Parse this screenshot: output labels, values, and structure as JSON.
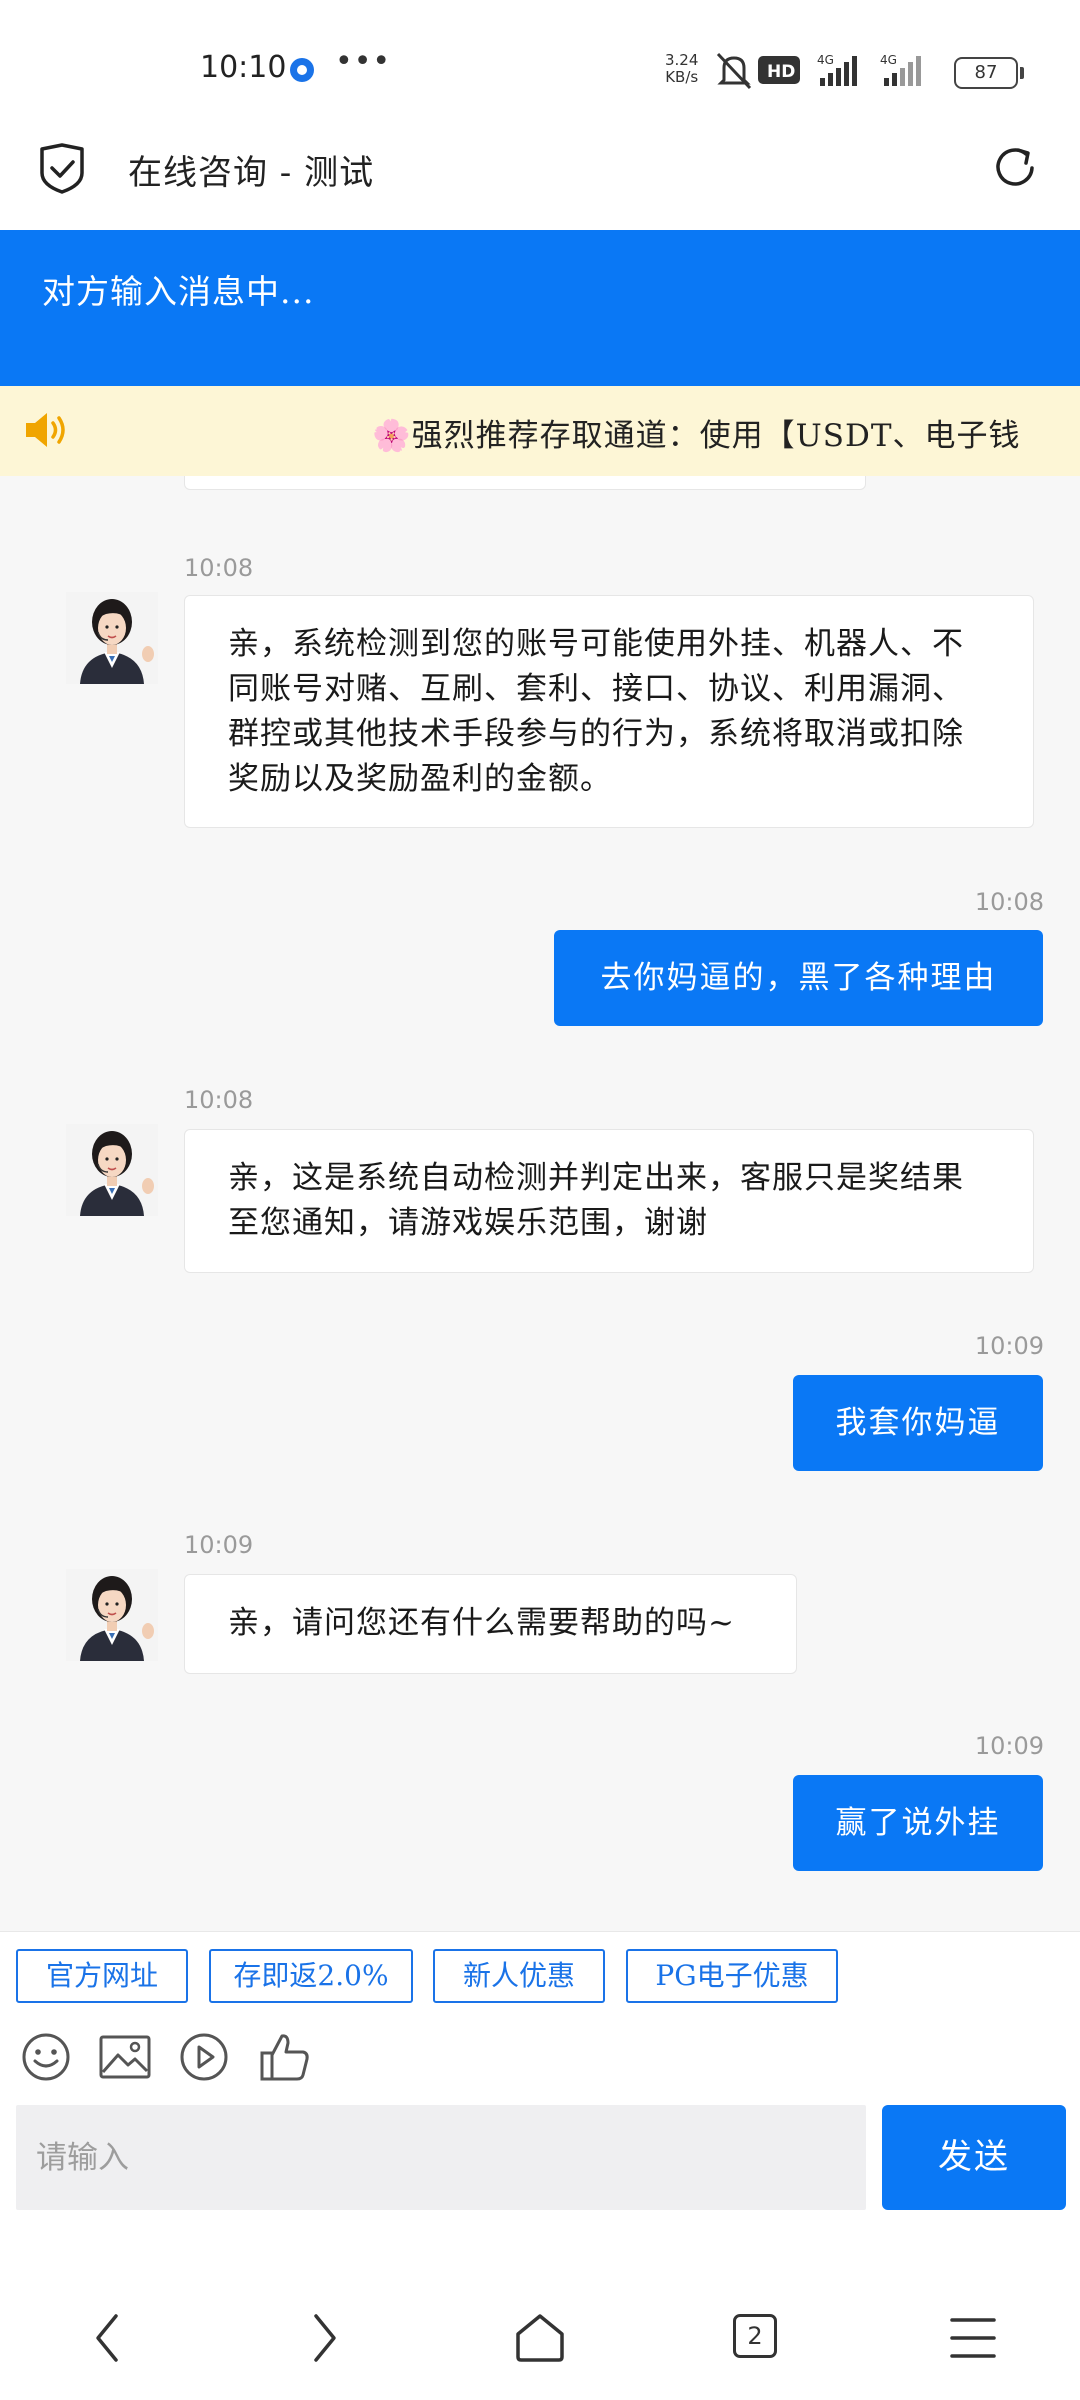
{
  "status_bar": {
    "time": "10:10",
    "more": "•••",
    "net_speed_value": "3.24",
    "net_speed_unit": "KB/s",
    "network_1": "4G",
    "network_2": "4G",
    "battery": "87",
    "hd_label": "HD"
  },
  "header": {
    "title": "在线咨询 - 测试"
  },
  "banner": {
    "typing_text": "对方输入消息中..."
  },
  "notice": {
    "text": "🌸强烈推荐存取通道：使用【USDT、电子钱"
  },
  "messages": [
    {
      "from": "agent",
      "time": "10:08",
      "text": "亲，系统检测到您的账号可能使用外挂、机器人、不同账号对赌、互刷、套利、接口、协议、利用漏洞、群控或其他技术手段参与的行为，系统将取消或扣除奖励以及奖励盈利的金额。"
    },
    {
      "from": "user",
      "time": "10:08",
      "text": "去你妈逼的，黑了各种理由"
    },
    {
      "from": "agent",
      "time": "10:08",
      "text": "亲，这是系统自动检测并判定出来，客服只是奖结果至您通知，请游戏娱乐范围，谢谢"
    },
    {
      "from": "user",
      "time": "10:09",
      "text": "我套你妈逼"
    },
    {
      "from": "agent",
      "time": "10:09",
      "text": "亲，请问您还有什么需要帮助的吗~"
    },
    {
      "from": "user",
      "time": "10:09",
      "text": "赢了说外挂"
    }
  ],
  "quick_actions": [
    "官方网址",
    "存即返2.0%",
    "新人优惠",
    "PG电子优惠"
  ],
  "input": {
    "placeholder": "请输入",
    "send_label": "发送"
  },
  "nav": {
    "tab_count": "2"
  },
  "colors": {
    "accent": "#0a78f5",
    "notice_bg": "#fdf6d6",
    "chat_bg": "#f7f7f7"
  }
}
